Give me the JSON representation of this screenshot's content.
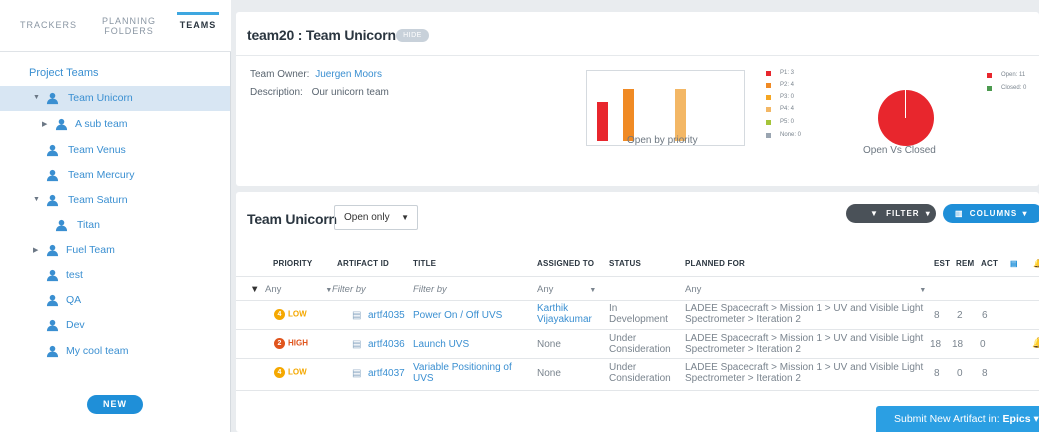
{
  "tabs": [
    "TRACKERS",
    "PLANNING\nFOLDERS",
    "TEAMS"
  ],
  "sidebar": {
    "section": "Project Teams",
    "items": [
      {
        "label": "Team Unicorn",
        "expanded": true
      },
      {
        "label": "A sub team",
        "collapsed": true
      },
      {
        "label": "Team Venus"
      },
      {
        "label": "Team Mercury"
      },
      {
        "label": "Team Saturn",
        "expanded": true
      },
      {
        "label": "Titan"
      },
      {
        "label": "Fuel Team",
        "collapsed": true
      },
      {
        "label": "test"
      },
      {
        "label": "QA"
      },
      {
        "label": "Dev"
      },
      {
        "label": "My cool team"
      }
    ],
    "new_label": "NEW"
  },
  "header": {
    "title": "team20 : Team Unicorn",
    "hide_label": "HIDE",
    "owner_label": "Team Owner:",
    "owner_value": "Juergen Moors",
    "desc_label": "Description:",
    "desc_value": "Our unicorn team"
  },
  "chart_data": [
    {
      "type": "bar",
      "title": "Open by priority",
      "categories": [
        "P1",
        "P2",
        "P3",
        "P4",
        "P5",
        "None"
      ],
      "values": [
        3,
        4,
        0,
        4,
        0,
        0
      ],
      "legend": [
        "P1: 3",
        "P2: 4",
        "P3: 0",
        "P4: 4",
        "P5: 0",
        "None: 0"
      ],
      "colors": [
        "#e8262d",
        "#f08a24",
        "#f5a623",
        "#f3b765",
        "#a4c439",
        "#9aa5b1"
      ]
    },
    {
      "type": "pie",
      "title": "Open Vs Closed",
      "categories": [
        "Open",
        "Closed"
      ],
      "values": [
        11,
        0
      ],
      "legend": [
        "Open: 11",
        "Closed: 0"
      ],
      "colors": [
        "#e8262d",
        "#4c9a4f"
      ]
    }
  ],
  "table": {
    "title": "Team Unicorn",
    "filter_select": "Open only",
    "filter_btn": "FILTER",
    "columns_btn": "COLUMNS",
    "headers": [
      "PRIORITY",
      "ARTIFACT ID",
      "TITLE",
      "ASSIGNED TO",
      "STATUS",
      "PLANNED FOR",
      "EST",
      "REM",
      "ACT"
    ],
    "filters": [
      "Any",
      "Filter by",
      "Filter by",
      "Any",
      "Any"
    ],
    "rows": [
      {
        "priority": "LOW",
        "prio_num": "4",
        "prio_color": "#f5a800",
        "id": "artf4035",
        "title": "Power On / Off UVS",
        "assigned": "Karthik\nVijayakumar",
        "assigned_link": true,
        "status": "In\nDevelopment",
        "planned": "LADEE Spacecraft > Mission 1 > UV and Visible Light\nSpectrometer > Iteration 2",
        "est": "8",
        "rem": "2",
        "act": "6"
      },
      {
        "priority": "HIGH",
        "prio_num": "2",
        "prio_color": "#e0541c",
        "id": "artf4036",
        "title": "Launch UVS",
        "assigned": "None",
        "assigned_link": false,
        "status": "Under\nConsideration",
        "planned": "LADEE Spacecraft > Mission 1 > UV and Visible Light\nSpectrometer > Iteration 2",
        "est": "18",
        "rem": "18",
        "act": "0"
      },
      {
        "priority": "LOW",
        "prio_num": "4",
        "prio_color": "#f5a800",
        "id": "artf4037",
        "title": "Variable Positioning of\nUVS",
        "assigned": "None",
        "assigned_link": false,
        "status": "Under\nConsideration",
        "planned": "LADEE Spacecraft > Mission 1 > UV and Visible Light\nSpectrometer > Iteration 2",
        "est": "8",
        "rem": "0",
        "act": "8"
      }
    ],
    "submit_prefix": "Submit New Artifact in:",
    "submit_target": "Epics"
  }
}
